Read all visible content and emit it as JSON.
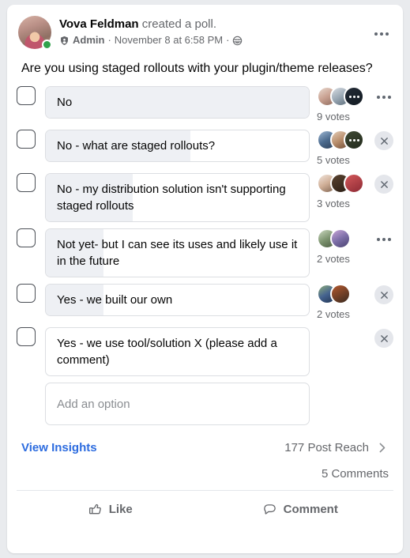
{
  "post": {
    "author": "Vova Feldman",
    "action_text": "created a poll.",
    "role_badge": "Admin",
    "separator": "·",
    "timestamp": "November 8 at 6:58 PM",
    "audience_icon": "group-audience-icon",
    "menu_icon": "more-options-icon",
    "avatar_icon": "author-avatar",
    "online_status": "online"
  },
  "question": "Are you using staged rollouts with your plugin/theme releases?",
  "poll": {
    "options": [
      {
        "label": "No",
        "votes_text": "9 votes",
        "votes": 9,
        "fill_percent": 100,
        "avatars": 3,
        "overflow_avatar": true,
        "action": "dots"
      },
      {
        "label": "No - what are staged rollouts?",
        "votes_text": "5 votes",
        "votes": 5,
        "fill_percent": 55,
        "avatars": 3,
        "overflow_avatar": true,
        "action": "close"
      },
      {
        "label": "No - my distribution solution isn't supporting staged rollouts",
        "votes_text": "3 votes",
        "votes": 3,
        "fill_percent": 33,
        "avatars": 3,
        "overflow_avatar": false,
        "action": "close"
      },
      {
        "label": "Not yet- but I can see its uses and likely use it in the future",
        "votes_text": "2 votes",
        "votes": 2,
        "fill_percent": 22,
        "avatars": 2,
        "overflow_avatar": false,
        "action": "dots"
      },
      {
        "label": "Yes - we built our own",
        "votes_text": "2 votes",
        "votes": 2,
        "fill_percent": 22,
        "avatars": 2,
        "overflow_avatar": false,
        "action": "close"
      },
      {
        "label": "Yes - we use tool/solution X (please add a comment)",
        "votes_text": "",
        "votes": 0,
        "fill_percent": 0,
        "avatars": 0,
        "overflow_avatar": false,
        "action": "close"
      }
    ],
    "add_option_placeholder": "Add an option"
  },
  "footer": {
    "view_insights": "View Insights",
    "post_reach": "177 Post Reach",
    "reach_chevron_icon": "chevron-right-icon",
    "comments": "5 Comments"
  },
  "actions": {
    "like": "Like",
    "like_icon": "thumbs-up-icon",
    "comment": "Comment",
    "comment_icon": "comment-bubble-icon"
  },
  "colors": {
    "link": "#2d6cdf",
    "bar_fill": "#eef0f4",
    "secondary_text": "#65676b",
    "primary_text": "#050505",
    "online": "#31a24c"
  }
}
